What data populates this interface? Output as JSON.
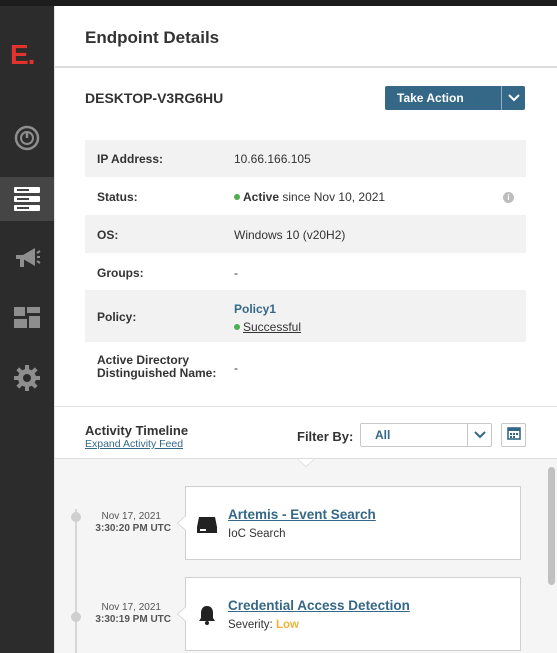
{
  "sidebar": {
    "logo": "E.",
    "items": [
      {
        "icon": "dashboard-gauge-icon",
        "active": false
      },
      {
        "icon": "endpoints-server-icon",
        "active": true
      },
      {
        "icon": "alerts-megaphone-icon",
        "active": false
      },
      {
        "icon": "components-blocks-icon",
        "active": false
      },
      {
        "icon": "settings-gear-icon",
        "active": false
      }
    ]
  },
  "header": {
    "title": "Endpoint Details"
  },
  "endpoint": {
    "hostname": "DESKTOP-V3RG6HU",
    "take_action_label": "Take Action"
  },
  "details": {
    "ip_label": "IP Address:",
    "ip_value": "10.66.166.105",
    "status_label": "Status:",
    "status_state": "Active",
    "status_since": "since Nov 10, 2021",
    "status_color": "#4caf50",
    "os_label": "OS:",
    "os_value": "Windows 10 (v20H2)",
    "groups_label": "Groups:",
    "groups_value": "-",
    "policy_label": "Policy:",
    "policy_name": "Policy1",
    "policy_status": "Successful",
    "ad_label_line1": "Active Directory",
    "ad_label_line2": "Distinguished Name:",
    "ad_value": "-"
  },
  "timeline": {
    "title": "Activity Timeline",
    "expand_link": "Expand Activity Feed",
    "filter_label": "Filter By:",
    "filter_value": "All",
    "events": [
      {
        "date": "Nov 17, 2021",
        "time": "3:30:20 PM UTC",
        "title": "Artemis - Event Search",
        "subtitle": "IoC Search",
        "icon": "search-bar-icon"
      },
      {
        "date": "Nov 17, 2021",
        "time": "3:30:19 PM UTC",
        "title": "Credential Access Detection",
        "severity_label": "Severity:",
        "severity_value": "Low",
        "icon": "bell-icon"
      }
    ]
  },
  "colors": {
    "brand_red": "#e0332b",
    "accent_blue": "#356887",
    "sidebar_bg": "#2c2c2c",
    "severity_low": "#f0b43c"
  }
}
